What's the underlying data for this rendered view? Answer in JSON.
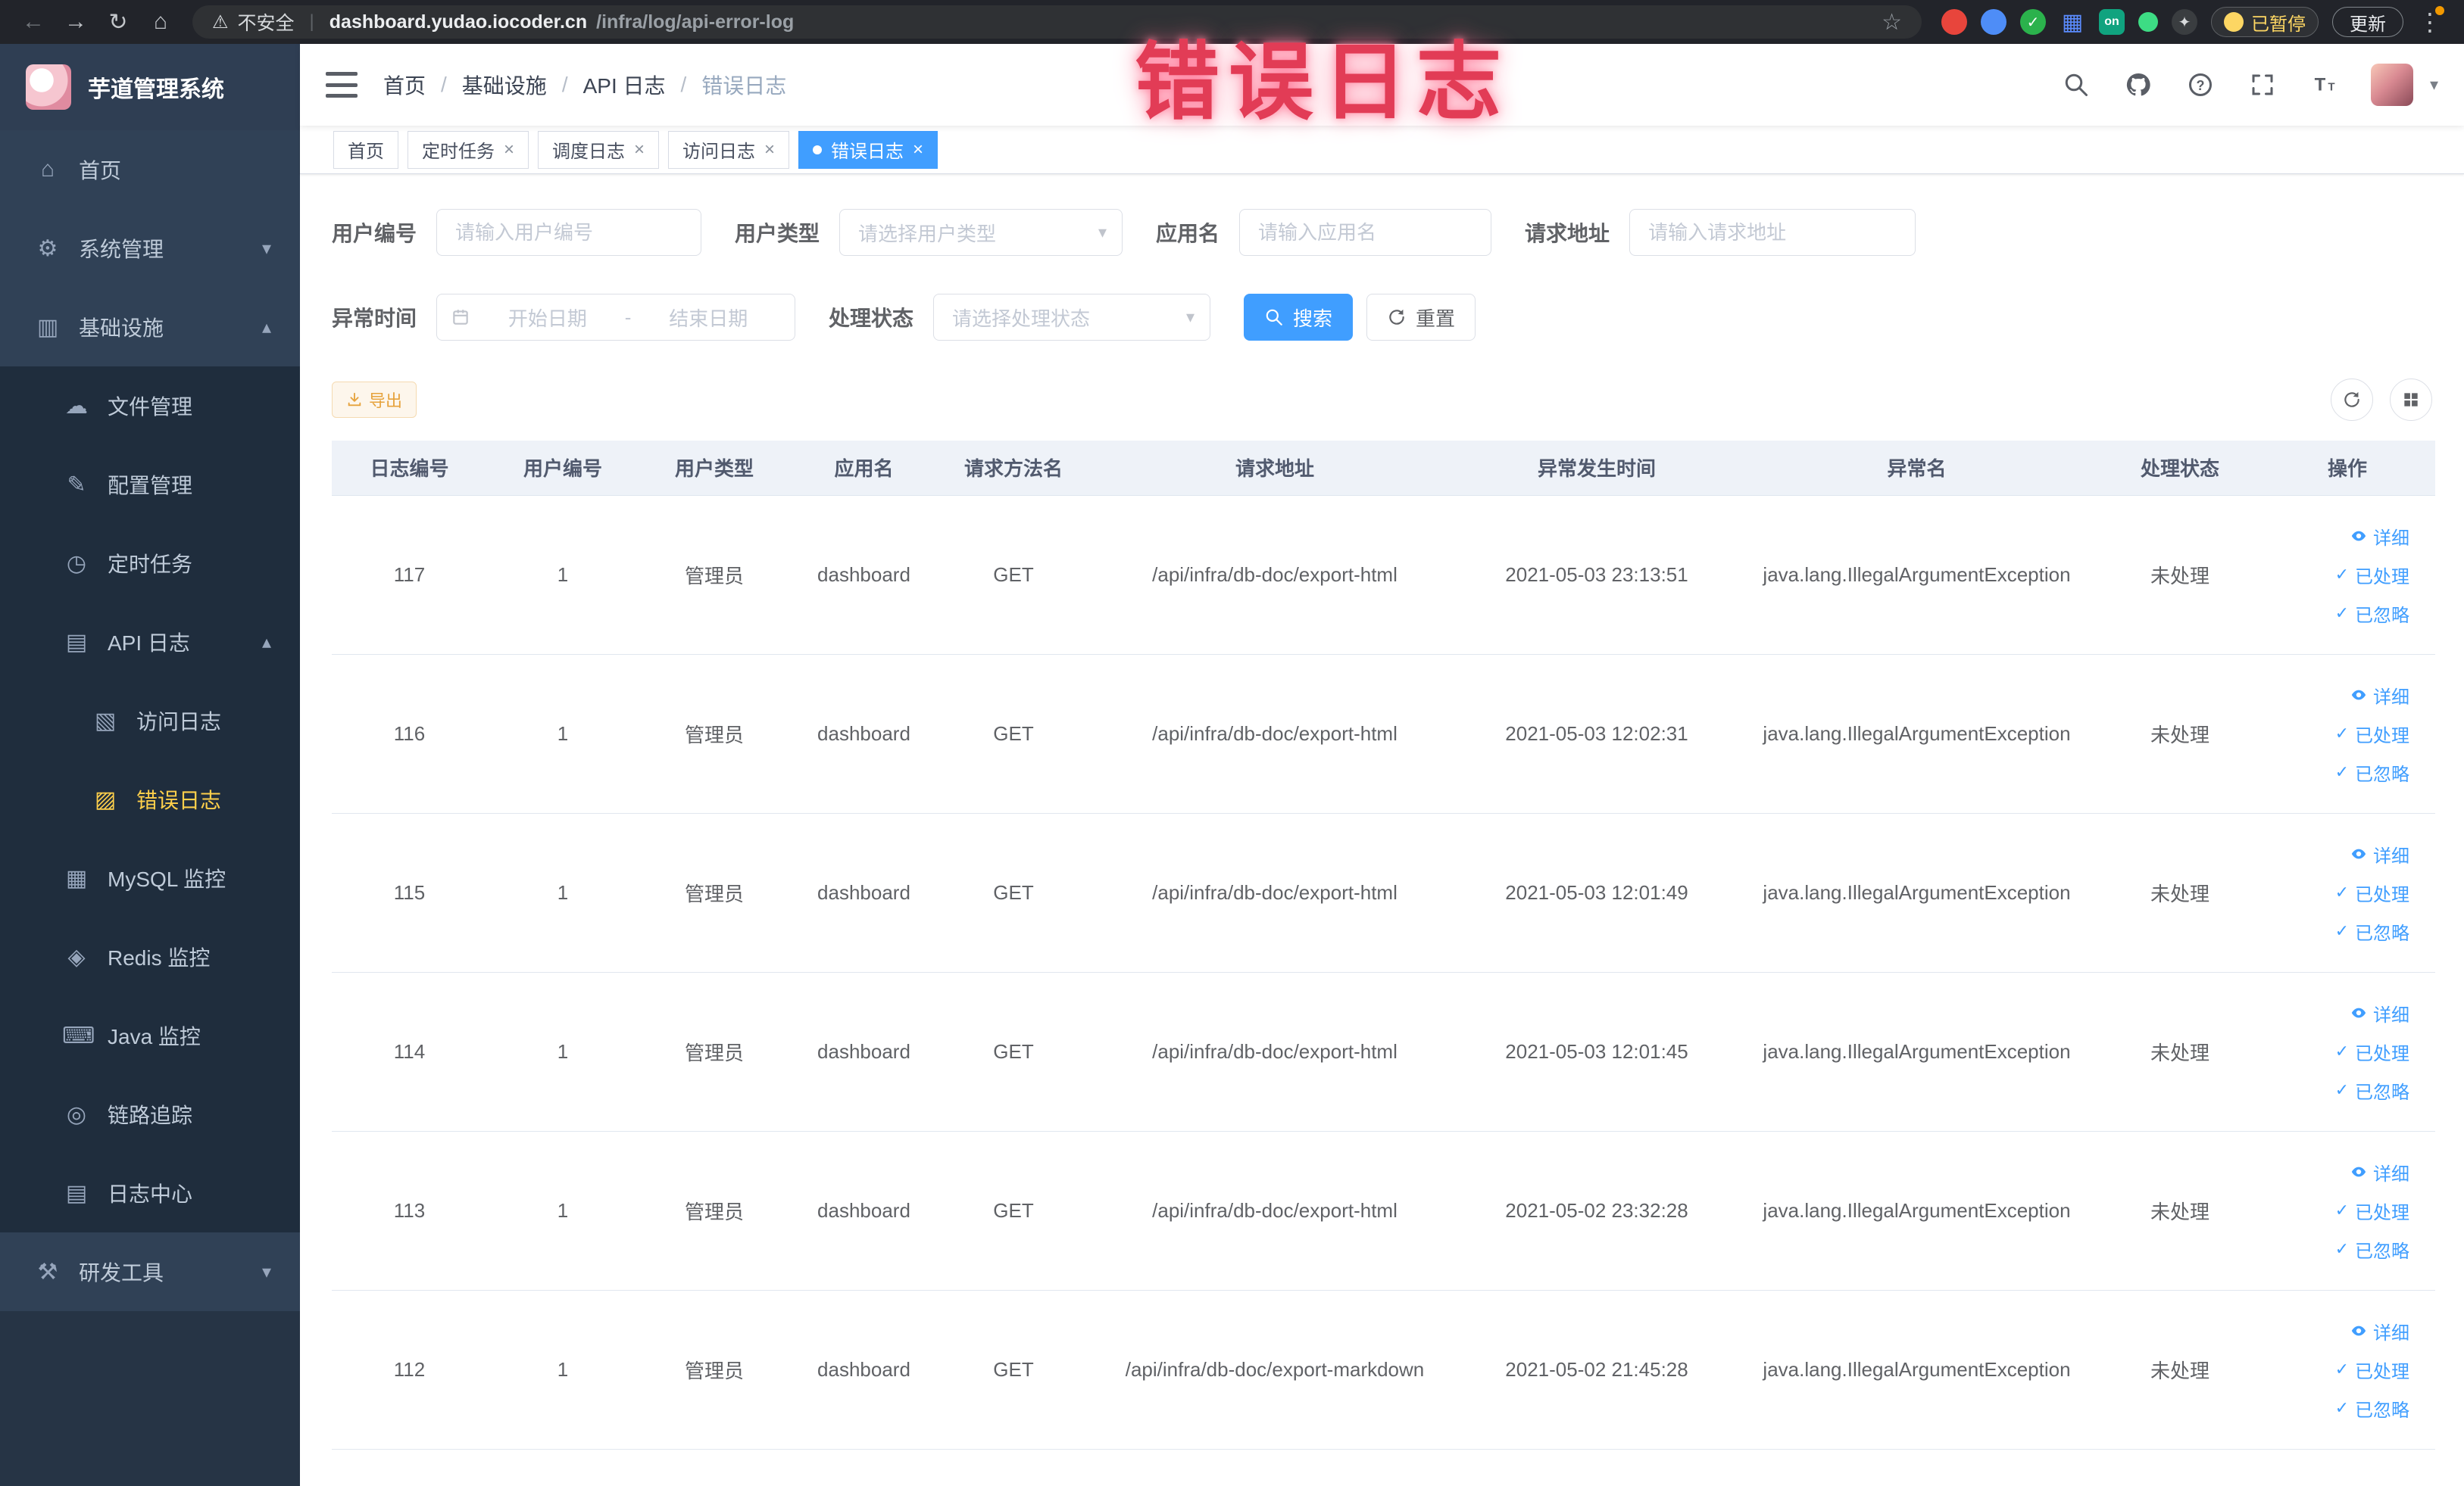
{
  "annotation": {
    "text": "错误日志"
  },
  "browser": {
    "security_label": "不安全",
    "url_host": "dashboard.yudao.iocoder.cn",
    "url_path": "/infra/log/api-error-log",
    "extension_on_badge": "on",
    "paused_badge": "已暂停",
    "update_button": "更新"
  },
  "sidebar": {
    "app_title": "芋道管理系统",
    "menu": {
      "home": "首页",
      "system": "系统管理",
      "infra": "基础设施",
      "file": "文件管理",
      "config": "配置管理",
      "job": "定时任务",
      "api_log": "API 日志",
      "access_log": "访问日志",
      "error_log": "错误日志",
      "mysql": "MySQL 监控",
      "redis": "Redis 监控",
      "java": "Java 监控",
      "trace": "链路追踪",
      "log_center": "日志中心",
      "dev_tools": "研发工具"
    }
  },
  "navbar": {
    "separator": "/",
    "crumbs": [
      "首页",
      "基础设施",
      "API 日志",
      "错误日志"
    ]
  },
  "tabs": {
    "items": [
      {
        "label": "首页"
      },
      {
        "label": "定时任务"
      },
      {
        "label": "调度日志"
      },
      {
        "label": "访问日志"
      },
      {
        "label": "错误日志"
      }
    ],
    "close_glyph": "×"
  },
  "filters": {
    "user_id_label": "用户编号",
    "user_id_placeholder": "请输入用户编号",
    "user_type_label": "用户类型",
    "user_type_placeholder": "请选择用户类型",
    "app_name_label": "应用名",
    "app_name_placeholder": "请输入应用名",
    "request_url_label": "请求地址",
    "request_url_placeholder": "请输入请求地址",
    "exception_time_label": "异常时间",
    "date_start_placeholder": "开始日期",
    "date_separator": "-",
    "date_end_placeholder": "结束日期",
    "process_status_label": "处理状态",
    "process_status_placeholder": "请选择处理状态",
    "search_button": "搜索",
    "reset_button": "重置"
  },
  "toolbar": {
    "export_button": "导出"
  },
  "table": {
    "columns": [
      "日志编号",
      "用户编号",
      "用户类型",
      "应用名",
      "请求方法名",
      "请求地址",
      "异常发生时间",
      "异常名",
      "处理状态",
      "操作"
    ],
    "action_detail": "详细",
    "action_done": "已处理",
    "action_ignore": "已忽略",
    "rows": [
      {
        "id": "117",
        "user_id": "1",
        "user_type": "管理员",
        "app_name": "dashboard",
        "method": "GET",
        "url": "/api/infra/db-doc/export-html",
        "time": "2021-05-03 23:13:51",
        "exception": "java.lang.IllegalArgumentException",
        "status": "未处理"
      },
      {
        "id": "116",
        "user_id": "1",
        "user_type": "管理员",
        "app_name": "dashboard",
        "method": "GET",
        "url": "/api/infra/db-doc/export-html",
        "time": "2021-05-03 12:02:31",
        "exception": "java.lang.IllegalArgumentException",
        "status": "未处理"
      },
      {
        "id": "115",
        "user_id": "1",
        "user_type": "管理员",
        "app_name": "dashboard",
        "method": "GET",
        "url": "/api/infra/db-doc/export-html",
        "time": "2021-05-03 12:01:49",
        "exception": "java.lang.IllegalArgumentException",
        "status": "未处理"
      },
      {
        "id": "114",
        "user_id": "1",
        "user_type": "管理员",
        "app_name": "dashboard",
        "method": "GET",
        "url": "/api/infra/db-doc/export-html",
        "time": "2021-05-03 12:01:45",
        "exception": "java.lang.IllegalArgumentException",
        "status": "未处理"
      },
      {
        "id": "113",
        "user_id": "1",
        "user_type": "管理员",
        "app_name": "dashboard",
        "method": "GET",
        "url": "/api/infra/db-doc/export-html",
        "time": "2021-05-02 23:32:28",
        "exception": "java.lang.IllegalArgumentException",
        "status": "未处理"
      },
      {
        "id": "112",
        "user_id": "1",
        "user_type": "管理员",
        "app_name": "dashboard",
        "method": "GET",
        "url": "/api/infra/db-doc/export-markdown",
        "time": "2021-05-02 21:45:28",
        "exception": "java.lang.IllegalArgumentException",
        "status": "未处理"
      }
    ]
  }
}
